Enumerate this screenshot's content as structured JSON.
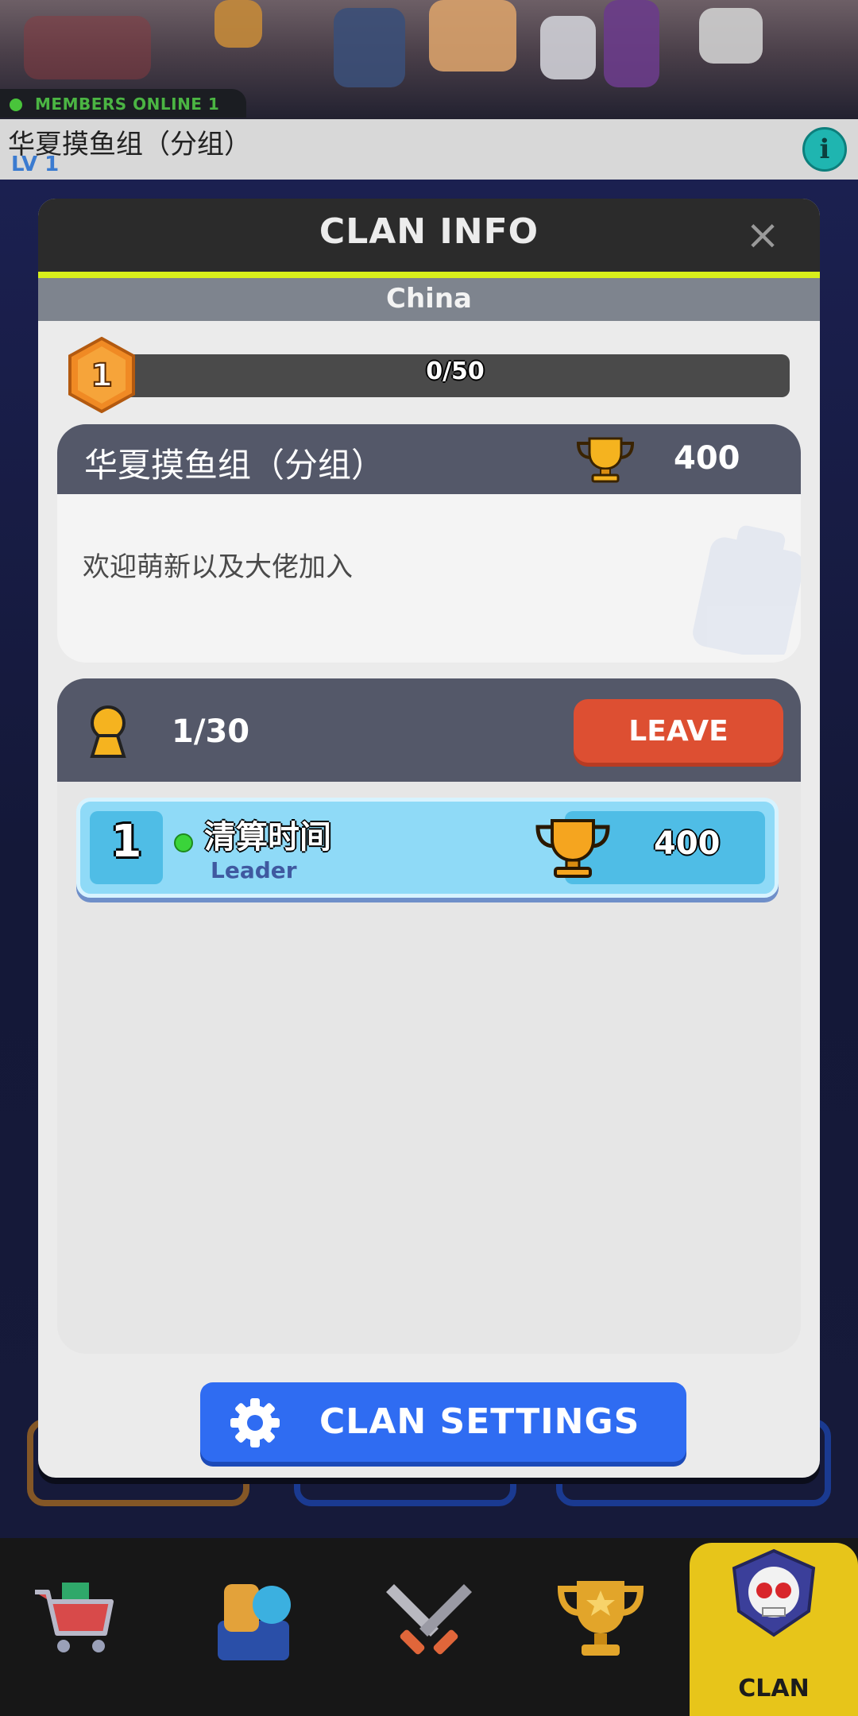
{
  "header": {
    "members_online": "MEMBERS ONLINE 1",
    "clan_name": "华夏摸鱼组（分组）",
    "clan_level": "LV 1",
    "info_icon": "info-icon"
  },
  "modal": {
    "title": "CLAN INFO",
    "close_icon": "close-icon",
    "region": "China",
    "level": "1",
    "xp_text": "0/50",
    "xp_progress": 0,
    "clan_name": "华夏摸鱼组（分组）",
    "clan_trophies": "400",
    "description": "欢迎萌新以及大佬加入",
    "member_count": "1/30",
    "leave_label": "LEAVE",
    "members": [
      {
        "rank": "1",
        "name": "清算时间",
        "role": "Leader",
        "trophies": "400",
        "online": true
      }
    ],
    "settings_label": "CLAN SETTINGS"
  },
  "nav": {
    "items": [
      {
        "icon": "shop-cart-icon"
      },
      {
        "icon": "collection-icon"
      },
      {
        "icon": "battle-swords-icon"
      },
      {
        "icon": "trophy-icon"
      },
      {
        "icon": "clan-skull-icon",
        "label": "CLAN",
        "active": true
      }
    ]
  },
  "colors": {
    "accent_yellow": "#e7c51a",
    "leave_red": "#dd4f32",
    "settings_blue": "#2f6cf2",
    "member_row": "#8fdaf7"
  }
}
